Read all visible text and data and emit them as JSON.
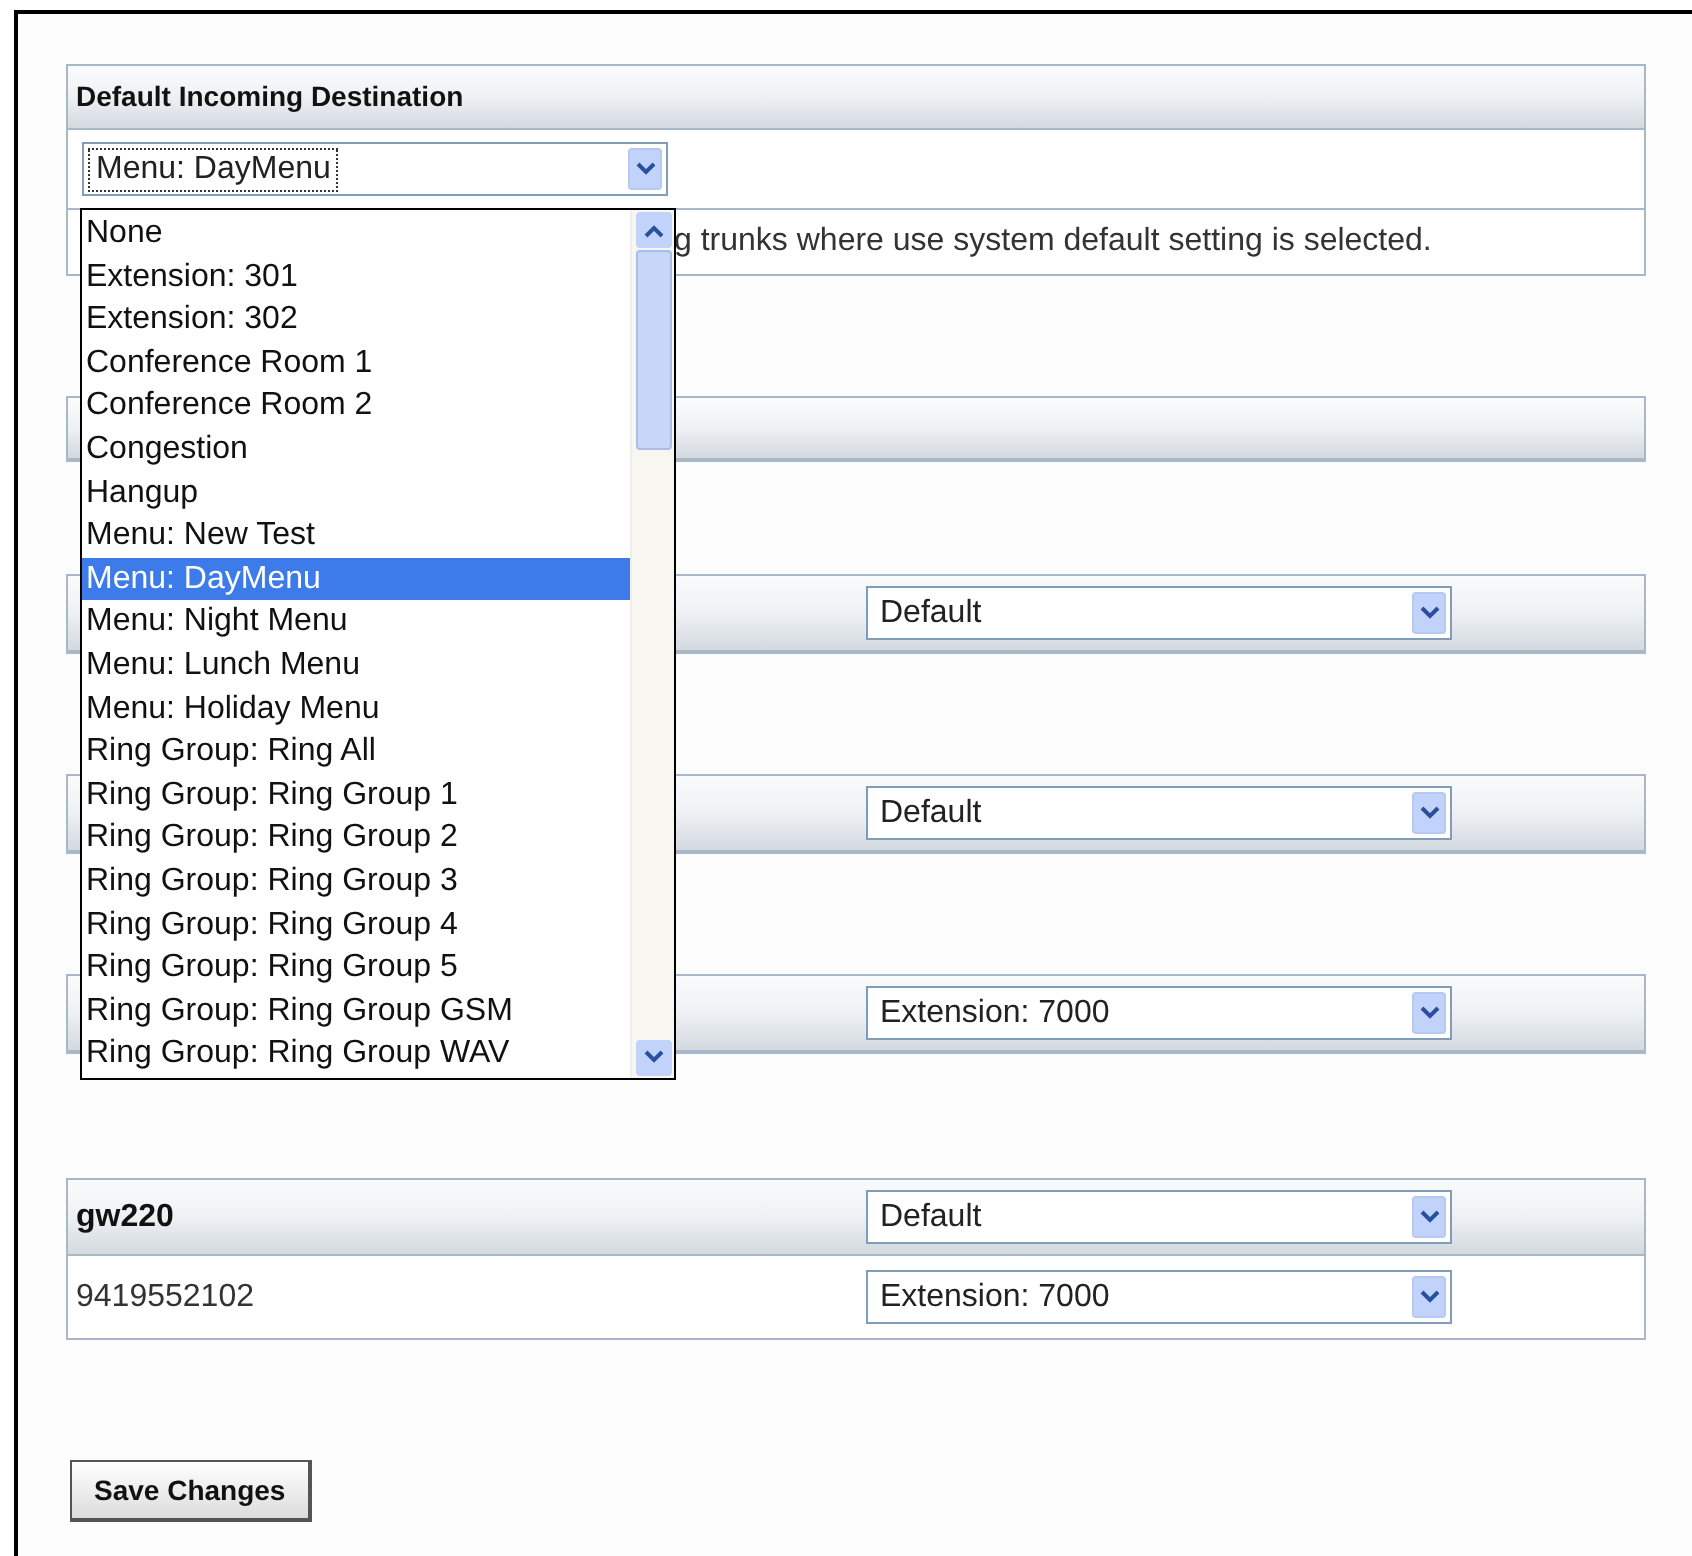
{
  "default_destination": {
    "title": "Default Incoming Destination",
    "select": {
      "value": "Menu: DayMenu",
      "expanded": true
    },
    "description": "g trunks where use system default setting is selected.",
    "options": [
      {
        "label": "None",
        "selected": false
      },
      {
        "label": "Extension: 301",
        "selected": false
      },
      {
        "label": "Extension: 302",
        "selected": false
      },
      {
        "label": "Conference Room 1",
        "selected": false
      },
      {
        "label": "Conference Room 2",
        "selected": false
      },
      {
        "label": "Congestion",
        "selected": false
      },
      {
        "label": "Hangup",
        "selected": false
      },
      {
        "label": "Menu: New Test",
        "selected": false
      },
      {
        "label": "Menu: DayMenu",
        "selected": true
      },
      {
        "label": "Menu: Night Menu",
        "selected": false
      },
      {
        "label": "Menu: Lunch Menu",
        "selected": false
      },
      {
        "label": "Menu: Holiday Menu",
        "selected": false
      },
      {
        "label": "Ring Group: Ring All",
        "selected": false
      },
      {
        "label": "Ring Group: Ring Group 1",
        "selected": false
      },
      {
        "label": "Ring Group: Ring Group 2",
        "selected": false
      },
      {
        "label": "Ring Group: Ring Group 3",
        "selected": false
      },
      {
        "label": "Ring Group: Ring Group 4",
        "selected": false
      },
      {
        "label": "Ring Group: Ring Group 5",
        "selected": false
      },
      {
        "label": "Ring Group: Ring Group GSM",
        "selected": false
      },
      {
        "label": "Ring Group: Ring Group WAV",
        "selected": false
      }
    ]
  },
  "sections": [
    {
      "kind": "header"
    },
    {
      "kind": "select-row",
      "select": {
        "value": "Default"
      }
    },
    {
      "kind": "select-row",
      "select": {
        "value": "Default"
      }
    },
    {
      "kind": "select-row",
      "select": {
        "value": "Extension: 7000"
      }
    },
    {
      "kind": "trunk",
      "title": "gw220",
      "select": {
        "value": "Default"
      },
      "rows": [
        {
          "number": "9419552102",
          "select": {
            "value": "Extension: 7000"
          }
        }
      ]
    }
  ],
  "save_button": "Save Changes"
}
